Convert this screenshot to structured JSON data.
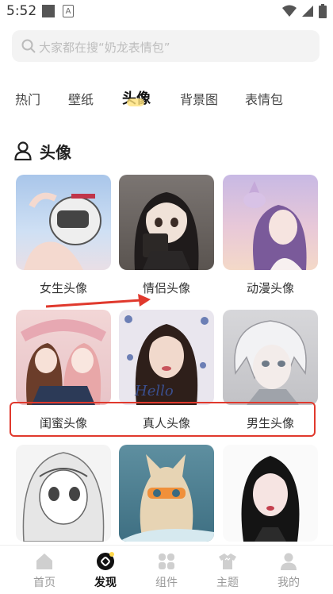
{
  "status_bar": {
    "time": "5:52",
    "icon_b_text": "A"
  },
  "search": {
    "placeholder": "大家都在搜“奶龙表情包”"
  },
  "tabs": [
    {
      "label": "热门",
      "active": false
    },
    {
      "label": "壁纸",
      "active": false
    },
    {
      "label": "头像",
      "active": true
    },
    {
      "label": "背景图",
      "active": false
    },
    {
      "label": "表情包",
      "active": false
    }
  ],
  "section": {
    "title": "头像",
    "icon": "person-icon"
  },
  "cards": [
    {
      "label": "女生头像"
    },
    {
      "label": "情侣头像"
    },
    {
      "label": "动漫头像"
    },
    {
      "label": "闺蜜头像"
    },
    {
      "label": "真人头像"
    },
    {
      "label": "男生头像"
    },
    {
      "label": ""
    },
    {
      "label": ""
    },
    {
      "label": ""
    }
  ],
  "overlay": {
    "thumb_text": "Hello"
  },
  "bottom_nav": [
    {
      "label": "首页",
      "icon": "home-icon",
      "active": false
    },
    {
      "label": "发现",
      "icon": "discover-icon",
      "active": true
    },
    {
      "label": "组件",
      "icon": "widgets-icon",
      "active": false
    },
    {
      "label": "主题",
      "icon": "theme-shirt-icon",
      "active": false
    },
    {
      "label": "我的",
      "icon": "profile-icon",
      "active": false
    }
  ],
  "colors": {
    "annotation_red": "#e0392d",
    "tab_indicator": "#ffe27a"
  }
}
